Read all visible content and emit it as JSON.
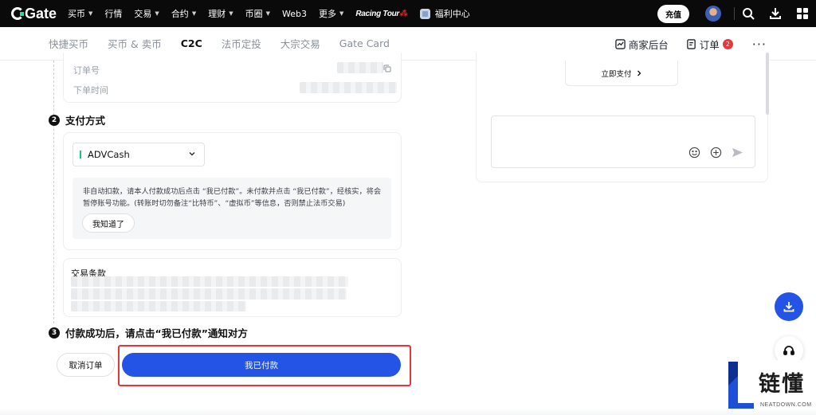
{
  "topbar": {
    "logo_text": "Gate",
    "menu": [
      {
        "label": "买币",
        "caret": true
      },
      {
        "label": "行情",
        "caret": false
      },
      {
        "label": "交易",
        "caret": true
      },
      {
        "label": "合约",
        "caret": true
      },
      {
        "label": "理财",
        "caret": true
      },
      {
        "label": "币圈",
        "caret": true
      },
      {
        "label": "Web3",
        "caret": false
      },
      {
        "label": "更多",
        "caret": true
      }
    ],
    "racing_label": "Racing Tour",
    "welfare_label": "福利中心",
    "deposit_label": "充值",
    "icons": [
      "search-icon",
      "download-icon",
      "grid-icon"
    ]
  },
  "subnav": {
    "tabs": [
      {
        "label": "快捷买币",
        "active": false
      },
      {
        "label": "买币 & 卖币",
        "active": false
      },
      {
        "label": "C2C",
        "active": true
      },
      {
        "label": "法币定投",
        "active": false
      },
      {
        "label": "大宗交易",
        "active": false
      },
      {
        "label": "Gate Card",
        "active": false
      }
    ],
    "merchant_label": "商家后台",
    "orders_label": "订单",
    "orders_badge": "2",
    "more_label": "···"
  },
  "order_info": {
    "order_no_label": "订单号",
    "order_time_label": "下单时间"
  },
  "step2": {
    "number": "2",
    "title": "支付方式",
    "payment_method": "ADVCash",
    "notice": "非自动扣款，请本人付款成功后点击 “我已付款”。未付款并点击 “我已付款”，经核实，将会暂停账号功能。(转账时切勿备注“比特币”、“虚拟币”等信息，否则禁止法币交易)",
    "ack_label": "我知道了",
    "terms_title": "交易条款"
  },
  "step3": {
    "number": "3",
    "title": "付款成功后，请点击“我已付款”通知对方"
  },
  "actions": {
    "cancel_label": "取消订单",
    "paid_label": "我已付款"
  },
  "chat": {
    "pay_now_label": "立即支付"
  },
  "watermark": {
    "cn": "链懂",
    "en": "NEATDOWN.COM"
  },
  "colors": {
    "primary": "#2354e6",
    "highlight": "#e0383e",
    "badge": "#e8373f",
    "method_bar": "#18c08a"
  }
}
